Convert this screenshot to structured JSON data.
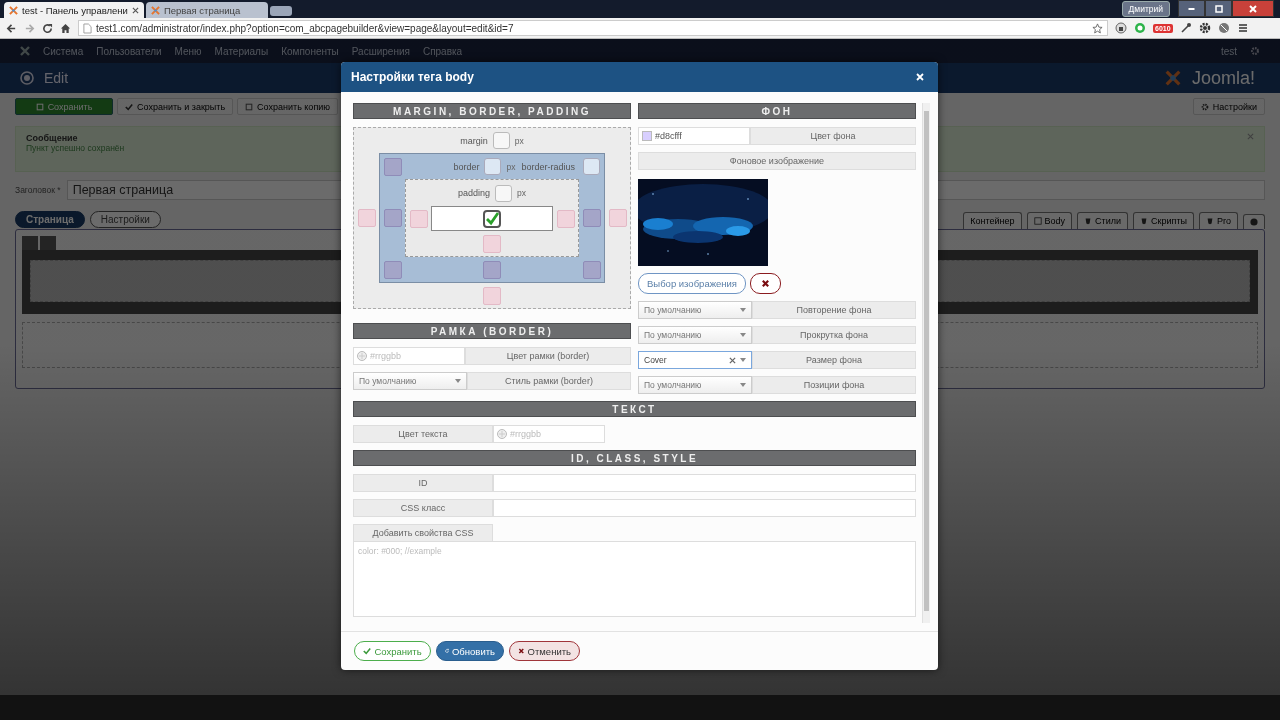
{
  "browser": {
    "tabs": [
      {
        "label": "test - Панель управлени",
        "selected": true
      },
      {
        "label": "Первая страница",
        "selected": false
      }
    ],
    "address": "test1.com/administrator/index.php?option=com_abcpagebuilder&view=page&layout=edit&id=7",
    "user": "Дмитрий",
    "mail_count": "6010"
  },
  "admin": {
    "menu": [
      "Система",
      "Пользователи",
      "Меню",
      "Материалы",
      "Компоненты",
      "Расширения",
      "Справка"
    ],
    "user": "test",
    "page_title": "Edit",
    "brand": "Joomla!",
    "toolbar": [
      {
        "label": "Сохранить",
        "kind": "primary"
      },
      {
        "label": "Сохранить и закрыть",
        "kind": "check"
      },
      {
        "label": "Сохранить копию",
        "kind": "copy"
      }
    ],
    "settings_button": "Настройки",
    "message": {
      "title": "Сообщение",
      "text": "Пункт успешно сохранён"
    },
    "title_field": {
      "label": "Заголовок *",
      "value": "Первая страница"
    },
    "page_tabs": [
      {
        "label": "Страница",
        "selected": true
      },
      {
        "label": "Настройки",
        "selected": false
      }
    ],
    "builder_tabs": [
      {
        "label": "Контейнер",
        "kind": "text"
      },
      {
        "label": "Body",
        "kind": "checkbox"
      },
      {
        "label": "Стили",
        "kind": "css"
      },
      {
        "label": "Скрипты",
        "kind": "wrench"
      },
      {
        "label": "Pro",
        "kind": "gears"
      },
      {
        "kind": "info"
      }
    ]
  },
  "dialog": {
    "title": "Настройки тега body",
    "box_model": {
      "heading": "MARGIN, BORDER, PADDING",
      "margin": {
        "label": "margin",
        "unit": "px"
      },
      "border": {
        "label": "border",
        "unit": "px"
      },
      "radius_label": "border-radius",
      "padding": {
        "label": "padding",
        "unit": "px"
      },
      "content_checked": true
    },
    "border_section": {
      "heading": "РАМКА (BORDER)",
      "color_placeholder": "#rrggbb",
      "color_label": "Цвет рамки (border)",
      "style_value": "По умолчанию",
      "style_label": "Стиль рамки (border)"
    },
    "background": {
      "heading": "ФОН",
      "color_value": "#d8cfff",
      "color_label": "Цвет фона",
      "image_label": "Фоновое изображение",
      "choose_button": "Выбор изображения",
      "options": [
        {
          "value": "По умолчанию",
          "label": "Повторение фона",
          "clearable": false,
          "focused": false
        },
        {
          "value": "По умолчанию",
          "label": "Прокрутка фона",
          "clearable": false,
          "focused": false
        },
        {
          "value": "Cover",
          "label": "Размер фона",
          "clearable": true,
          "focused": true
        },
        {
          "value": "По умолчанию",
          "label": "Позиции фона",
          "clearable": false,
          "focused": false
        }
      ]
    },
    "text_section": {
      "heading": "ТЕКСТ",
      "color_label": "Цвет текста",
      "color_placeholder": "#rrggbb"
    },
    "attributes": {
      "heading": "ID, CLASS, STYLE",
      "fields": [
        {
          "label": "ID"
        },
        {
          "label": "CSS класс"
        }
      ],
      "css_label": "Добавить свойства CSS",
      "css_placeholder": "color: #000; //example"
    },
    "buttons": [
      {
        "label": "Сохранить",
        "kind": "save"
      },
      {
        "label": "Обновить",
        "kind": "refresh"
      },
      {
        "label": "Отменить",
        "kind": "cancel"
      }
    ]
  }
}
